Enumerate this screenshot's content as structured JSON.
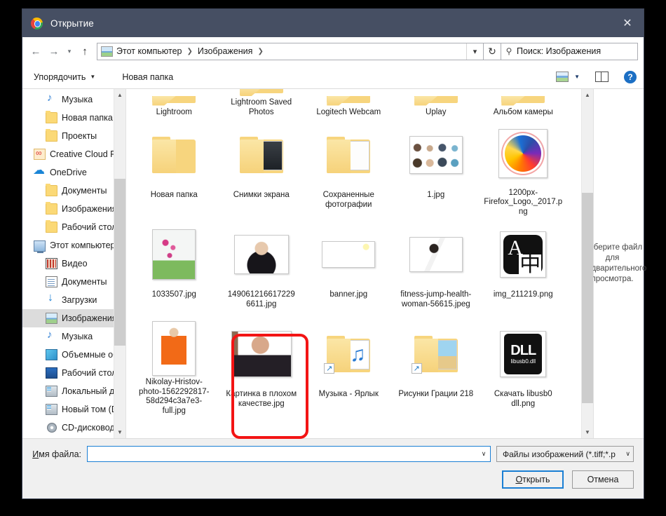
{
  "window": {
    "title": "Открытие",
    "app_icon": "chrome-icon",
    "close_label": "✕"
  },
  "nav": {
    "back_icon": "arrow-left-icon",
    "forward_icon": "arrow-right-icon",
    "recent_icon": "chevron-down-icon",
    "up_icon": "arrow-up-icon",
    "breadcrumb_icon": "pictures-folder-icon",
    "breadcrumbs": [
      "Этот компьютер",
      "Изображения"
    ],
    "separator": "❯",
    "dropdown_icon": "chevron-down-icon",
    "refresh_icon": "refresh-icon",
    "search_icon": "search-icon",
    "search_placeholder": "Поиск: Изображения",
    "search_value": ""
  },
  "commandbar": {
    "organize_label": "Упорядочить",
    "organize_caret": "▼",
    "new_folder_label": "Новая папка",
    "view_icon": "view-mode-icon",
    "view_caret": "▼",
    "preview_pane_icon": "preview-pane-icon",
    "help_icon": "help-icon",
    "help_glyph": "?"
  },
  "sidebar": {
    "items": [
      {
        "label": "Музыка",
        "icon": "music-icon",
        "indent": 1,
        "selected": false
      },
      {
        "label": "Новая папка",
        "icon": "folder-icon",
        "indent": 1,
        "selected": false
      },
      {
        "label": "Проекты",
        "icon": "folder-icon",
        "indent": 1,
        "selected": false
      },
      {
        "label": "Creative Cloud Fil",
        "icon": "creative-cloud-icon",
        "indent": 0,
        "selected": false
      },
      {
        "label": "OneDrive",
        "icon": "onedrive-icon",
        "indent": 0,
        "selected": false
      },
      {
        "label": "Документы",
        "icon": "folder-icon",
        "indent": 1,
        "selected": false
      },
      {
        "label": "Изображения",
        "icon": "folder-icon",
        "indent": 1,
        "selected": false
      },
      {
        "label": "Рабочий стол",
        "icon": "folder-icon",
        "indent": 1,
        "selected": false
      },
      {
        "label": "Этот компьютер",
        "icon": "this-pc-icon",
        "indent": 0,
        "selected": false
      },
      {
        "label": "Видео",
        "icon": "videos-icon",
        "indent": 1,
        "selected": false
      },
      {
        "label": "Документы",
        "icon": "documents-icon",
        "indent": 1,
        "selected": false
      },
      {
        "label": "Загрузки",
        "icon": "downloads-icon",
        "indent": 1,
        "selected": false
      },
      {
        "label": "Изображения",
        "icon": "pictures-icon",
        "indent": 1,
        "selected": true
      },
      {
        "label": "Музыка",
        "icon": "music-icon",
        "indent": 1,
        "selected": false
      },
      {
        "label": "Объемные объ",
        "icon": "3d-objects-icon",
        "indent": 1,
        "selected": false
      },
      {
        "label": "Рабочий стол",
        "icon": "desktop-icon",
        "indent": 1,
        "selected": false
      },
      {
        "label": "Локальный дис",
        "icon": "drive-icon",
        "indent": 1,
        "selected": false
      },
      {
        "label": "Новый том (D:)",
        "icon": "drive-icon",
        "indent": 1,
        "selected": false
      },
      {
        "label": "CD-дисковод (F",
        "icon": "cd-drive-icon",
        "indent": 1,
        "selected": false
      }
    ],
    "scroll_up_icon": "chevron-up-icon",
    "scroll_down_icon": "chevron-down-icon"
  },
  "files": {
    "scroll_up_icon": "chevron-up-icon",
    "scroll_down_icon": "chevron-down-icon",
    "items": [
      {
        "name": "Lightroom",
        "kind": "folder-tip",
        "row": 0
      },
      {
        "name": "Lightroom Saved Photos",
        "kind": "folder-tip",
        "row": 0
      },
      {
        "name": "Logitech Webcam",
        "kind": "folder-tip",
        "row": 0
      },
      {
        "name": "Uplay",
        "kind": "folder-tip",
        "row": 0
      },
      {
        "name": "Альбом камеры",
        "kind": "folder-tip",
        "row": 0
      },
      {
        "name": "Новая папка",
        "kind": "folder-empty",
        "row": 1
      },
      {
        "name": "Снимки экрана",
        "kind": "folder-preview",
        "row": 1,
        "preview": "screenshots"
      },
      {
        "name": "Сохраненные фотографии",
        "kind": "folder-preview",
        "row": 1,
        "preview": "docs"
      },
      {
        "name": "1.jpg",
        "kind": "image",
        "row": 1,
        "preview": "people"
      },
      {
        "name": "1200px-Firefox_Logo,_2017.png",
        "kind": "image",
        "row": 1,
        "preview": "firefox"
      },
      {
        "name": "1033507.jpg",
        "kind": "image",
        "row": 2,
        "preview": "flowers"
      },
      {
        "name": "149061216617229 6611.jpg",
        "kind": "image",
        "row": 2,
        "preview": "portrait"
      },
      {
        "name": "banner.jpg",
        "kind": "image",
        "row": 2,
        "preview": "banner"
      },
      {
        "name": "fitness-jump-health-woman-56615.jpeg",
        "kind": "image",
        "row": 2,
        "preview": "fitness"
      },
      {
        "name": "img_211219.png",
        "kind": "image",
        "row": 2,
        "preview": "translate"
      },
      {
        "name": "Nikolay-Hristov-photo-1562292817-58d294c3a7e3-full.jpg",
        "kind": "image",
        "row": 3,
        "preview": "orangedress"
      },
      {
        "name": "Картинка в плохом качестве.jpg",
        "kind": "image",
        "row": 3,
        "preview": "lowquality",
        "highlighted": true
      },
      {
        "name": "Музыка - Ярлык",
        "kind": "folder-shortcut",
        "row": 3,
        "preview": "music"
      },
      {
        "name": "Рисунки Грации 218",
        "kind": "folder-shortcut",
        "row": 3,
        "preview": "picture"
      },
      {
        "name": "Скачать libusb0 dll.png",
        "kind": "image",
        "row": 3,
        "preview": "dll"
      }
    ],
    "dll_glyph": "DLL",
    "dll_sub": "libusb0.dll"
  },
  "preview_pane": {
    "text": "Выберите файл для предварительного просмотра."
  },
  "footer": {
    "filename_label": "Имя файла:",
    "filename_value": "",
    "filename_caret": "∨",
    "filetype_value": "Файлы изображений (*.tiff;*.p",
    "filetype_caret": "∨",
    "open_label": "Открыть",
    "cancel_label": "Отмена"
  },
  "annotation": {
    "color": "#f31414",
    "target": "Картинка в плохом качестве.jpg"
  }
}
